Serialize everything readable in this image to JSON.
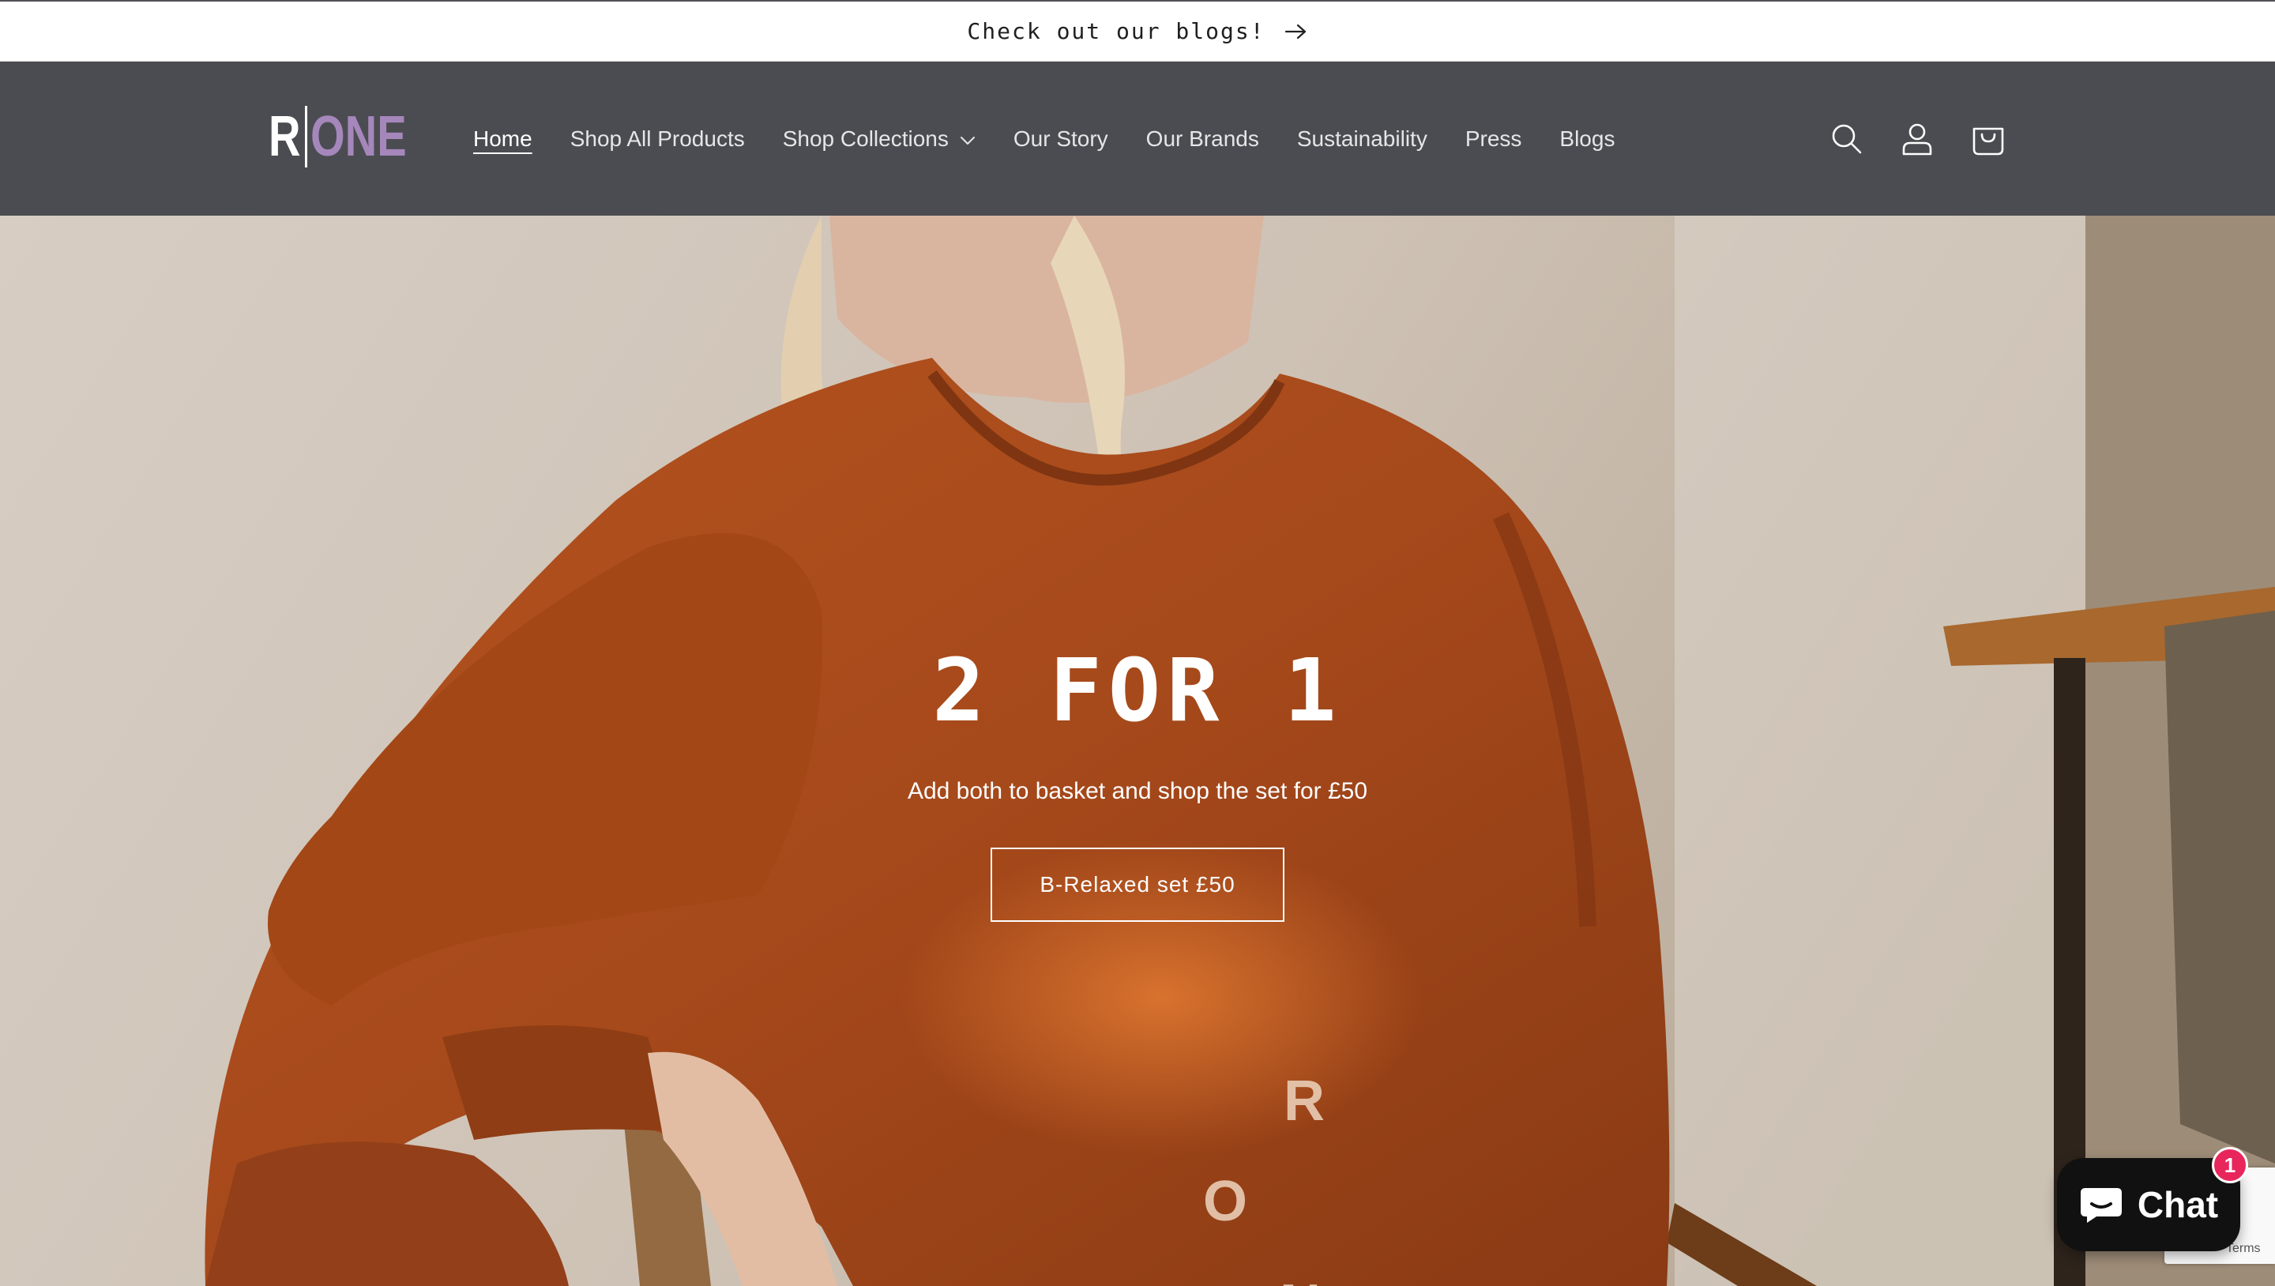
{
  "announcement": {
    "text": "Check out our blogs!"
  },
  "logo": {
    "left": "R",
    "right": "ONE"
  },
  "nav": {
    "items": [
      {
        "label": "Home",
        "active": true
      },
      {
        "label": "Shop All Products"
      },
      {
        "label": "Shop Collections",
        "has_dropdown": true
      },
      {
        "label": "Our Story"
      },
      {
        "label": "Our Brands"
      },
      {
        "label": "Sustainability"
      },
      {
        "label": "Press"
      },
      {
        "label": "Blogs"
      }
    ]
  },
  "header_icons": [
    "search-icon",
    "account-icon",
    "cart-icon"
  ],
  "hero": {
    "title": "2 FOR 1",
    "subtitle": "Add both to basket and shop the set for £50",
    "button_label": "B-Relaxed set £50"
  },
  "chat": {
    "label": "Chat",
    "badge_count": "1"
  },
  "recaptcha": {
    "terms": "Terms"
  },
  "colors": {
    "header_bg": "#4b4c51",
    "logo_accent": "#a587bb",
    "sweater": "#a84a1c",
    "chat_bg": "#111111",
    "badge": "#e8265c"
  }
}
